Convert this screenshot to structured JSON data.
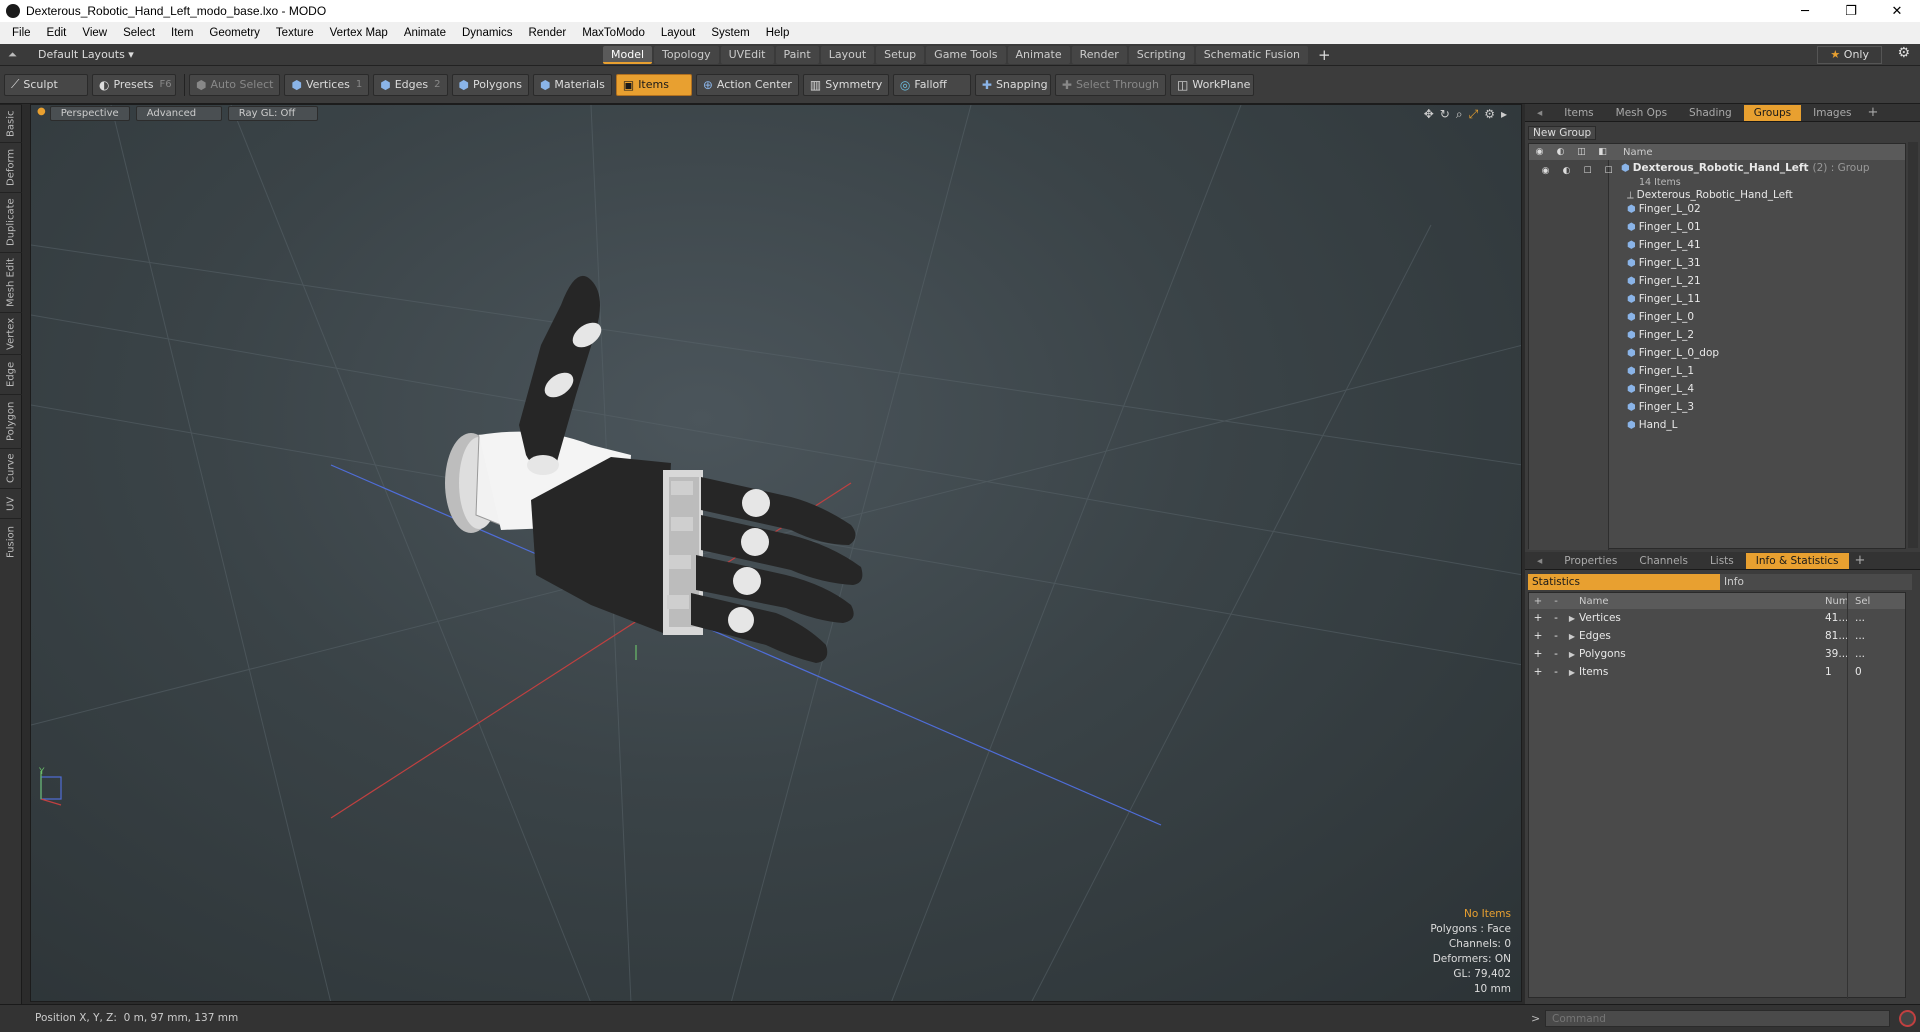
{
  "window": {
    "title": "Dexterous_Robotic_Hand_Left_modo_base.lxo - MODO",
    "minimize": "─",
    "maximize": "❐",
    "close": "✕"
  },
  "menu": [
    "File",
    "Edit",
    "View",
    "Select",
    "Item",
    "Geometry",
    "Texture",
    "Vertex Map",
    "Animate",
    "Dynamics",
    "Render",
    "MaxToModo",
    "Layout",
    "System",
    "Help"
  ],
  "modebar": {
    "layout": "Default Layouts ▾",
    "tabs": [
      "Model",
      "Topology",
      "UVEdit",
      "Paint",
      "Layout",
      "Setup",
      "Game Tools",
      "Animate",
      "Render",
      "Scripting",
      "Schematic Fusion"
    ],
    "active_tab": "Model",
    "only_label": "Only"
  },
  "toolbar": {
    "sculpt": "Sculpt",
    "presets": "Presets",
    "presets_key": "F6",
    "auto_select": "Auto Select",
    "vertices": "Vertices",
    "vertices_count": "1",
    "edges": "Edges",
    "edges_count": "2",
    "polygons": "Polygons",
    "materials": "Materials",
    "items": "Items",
    "action_center": "Action Center",
    "symmetry": "Symmetry",
    "falloff": "Falloff",
    "snapping": "Snapping",
    "select_through": "Select Through",
    "workplane": "WorkPlane"
  },
  "left_tabs": [
    "Basic",
    "Deform",
    "Duplicate",
    "Mesh Edit",
    "Vertex",
    "Edge",
    "Polygon",
    "Curve",
    "UV",
    "Fusion"
  ],
  "viewport": {
    "perspective": "Perspective",
    "advanced": "Advanced",
    "raygl": "Ray GL: Off",
    "info": {
      "no_items": "No Items",
      "polygons": "Polygons : Face",
      "channels": "Channels: 0",
      "deformers": "Deformers: ON",
      "gl": "GL: 79,402",
      "scale": "10 mm"
    },
    "axis_y": "Y"
  },
  "status": {
    "position_label": "Position X, Y, Z:",
    "position_value": "0 m, 97 mm, 137 mm"
  },
  "groups_panel": {
    "tabs": [
      "Items",
      "Mesh Ops",
      "Shading",
      "Groups",
      "Images"
    ],
    "active_tab": "Groups",
    "new_group": "New Group",
    "name_header": "Name",
    "group_name": "Dexterous_Robotic_Hand_Left",
    "group_count": "(2) : Group",
    "group_items": "14 Items",
    "children": [
      "Dexterous_Robotic_Hand_Left",
      "Finger_L_02",
      "Finger_L_01",
      "Finger_L_41",
      "Finger_L_31",
      "Finger_L_21",
      "Finger_L_11",
      "Finger_L_0",
      "Finger_L_2",
      "Finger_L_0_dop",
      "Finger_L_1",
      "Finger_L_4",
      "Finger_L_3",
      "Hand_L"
    ]
  },
  "stats_panel": {
    "tabs": [
      "Properties",
      "Channels",
      "Lists",
      "Info & Statistics"
    ],
    "active_tab": "Info & Statistics",
    "subtabs": [
      "Statistics",
      "Info"
    ],
    "headers": {
      "name": "Name",
      "num": "Num",
      "sel": "Sel"
    },
    "rows": [
      {
        "name": "Vertices",
        "num": "41...",
        "sel": "..."
      },
      {
        "name": "Edges",
        "num": "81...",
        "sel": "..."
      },
      {
        "name": "Polygons",
        "num": "39...",
        "sel": "..."
      },
      {
        "name": "Items",
        "num": "1",
        "sel": "0"
      }
    ]
  },
  "command": {
    "prompt": ">",
    "placeholder": "Command"
  },
  "colors": {
    "accent": "#e8a030",
    "mesh_icon": "#8ab4e8"
  }
}
